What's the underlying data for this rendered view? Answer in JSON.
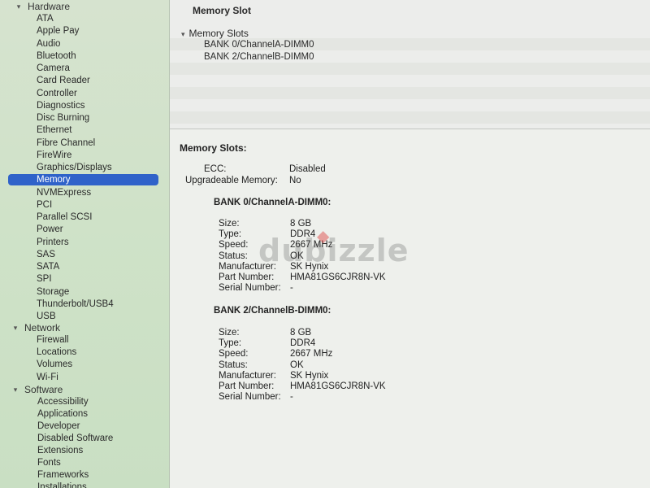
{
  "sidebar": {
    "hardware": {
      "label": "Hardware",
      "items": [
        "ATA",
        "Apple Pay",
        "Audio",
        "Bluetooth",
        "Camera",
        "Card Reader",
        "Controller",
        "Diagnostics",
        "Disc Burning",
        "Ethernet",
        "Fibre Channel",
        "FireWire",
        "Graphics/Displays",
        "Memory",
        "NVMExpress",
        "PCI",
        "Parallel SCSI",
        "Power",
        "Printers",
        "SAS",
        "SATA",
        "SPI",
        "Storage",
        "Thunderbolt/USB4",
        "USB"
      ],
      "selected": "Memory"
    },
    "network": {
      "label": "Network",
      "items": [
        "Firewall",
        "Locations",
        "Volumes",
        "Wi-Fi"
      ]
    },
    "software": {
      "label": "Software",
      "items": [
        "Accessibility",
        "Applications",
        "Developer",
        "Disabled Software",
        "Extensions",
        "Fonts",
        "Frameworks",
        "Installations"
      ]
    }
  },
  "top_pane": {
    "column_title": "Memory Slot",
    "tree_header": "Memory Slots",
    "rows": [
      "BANK 0/ChannelA-DIMM0",
      "BANK 2/ChannelB-DIMM0"
    ]
  },
  "detail": {
    "heading": "Memory Slots:",
    "ecc_label": "ECC:",
    "ecc_value": "Disabled",
    "upgradeable_label": "Upgradeable Memory:",
    "upgradeable_value": "No",
    "banks": [
      {
        "title": "BANK 0/ChannelA-DIMM0:",
        "fields": [
          {
            "label": "Size:",
            "value": "8 GB"
          },
          {
            "label": "Type:",
            "value": "DDR4"
          },
          {
            "label": "Speed:",
            "value": "2667 MHz"
          },
          {
            "label": "Status:",
            "value": "OK"
          },
          {
            "label": "Manufacturer:",
            "value": "SK Hynix"
          },
          {
            "label": "Part Number:",
            "value": "HMA81GS6CJR8N-VK"
          },
          {
            "label": "Serial Number:",
            "value": "-"
          }
        ]
      },
      {
        "title": "BANK 2/ChannelB-DIMM0:",
        "fields": [
          {
            "label": "Size:",
            "value": "8 GB"
          },
          {
            "label": "Type:",
            "value": "DDR4"
          },
          {
            "label": "Speed:",
            "value": "2667 MHz"
          },
          {
            "label": "Status:",
            "value": "OK"
          },
          {
            "label": "Manufacturer:",
            "value": "SK Hynix"
          },
          {
            "label": "Part Number:",
            "value": "HMA81GS6CJR8N-VK"
          },
          {
            "label": "Serial Number:",
            "value": "-"
          }
        ]
      }
    ]
  },
  "watermark": "dubizzle",
  "colors": {
    "selection": "#2f62c9",
    "sidebar": "#cfe2c8"
  }
}
